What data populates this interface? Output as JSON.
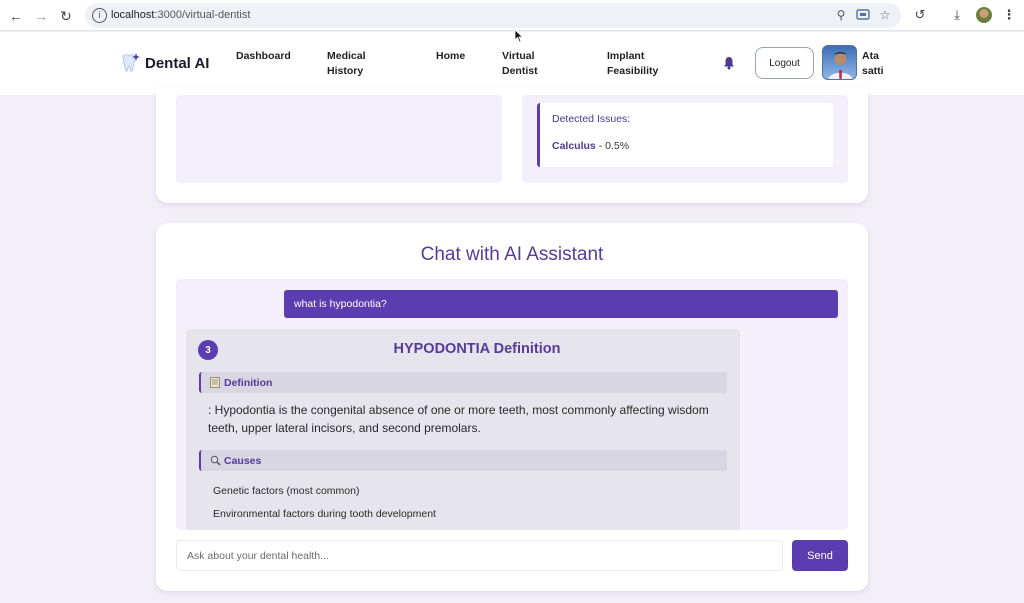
{
  "browser": {
    "url_host": "localhost",
    "url_path": ":3000/virtual-dentist",
    "icons": [
      "back-icon",
      "forward-icon",
      "reload-icon",
      "site-info-icon",
      "zoom-icon",
      "cast-icon",
      "star-icon",
      "history-icon",
      "download-icon",
      "profile-icon",
      "more-icon"
    ]
  },
  "header": {
    "logo_text": "Dental AI",
    "nav": {
      "dashboard": "Dashboard",
      "medical_history_1": "Medical",
      "medical_history_2": "History",
      "home": "Home",
      "virtual_dentist_1": "Virtual",
      "virtual_dentist_2": "Dentist",
      "implant_1": "Implant",
      "implant_2": "Feasibility"
    },
    "logout_label": "Logout",
    "user_first": "Ata",
    "user_last": "satti"
  },
  "analysis": {
    "issues_title": "Detected Issues:",
    "issue_name": "Calculus",
    "issue_value": " - 0.5%"
  },
  "chat": {
    "title": "Chat with AI Assistant",
    "user_message": "what is hypodontia?",
    "bot": {
      "step": "3",
      "heading": "HYPODONTIA Definition",
      "definition_label": "Definition",
      "definition_text": ": Hypodontia is the congenital absence of one or more teeth, most commonly affecting wisdom teeth, upper lateral incisors, and second premolars.",
      "causes_label": "Causes",
      "causes": [
        "Genetic factors (most common)",
        "Environmental factors during tooth development"
      ]
    },
    "input_placeholder": "Ask about your dental health...",
    "send_label": "Send"
  },
  "colors": {
    "accent": "#5b3db0",
    "heading": "#553c9a",
    "panel_bg": "#f4f0fb",
    "page_bg": "#f3eff9"
  }
}
